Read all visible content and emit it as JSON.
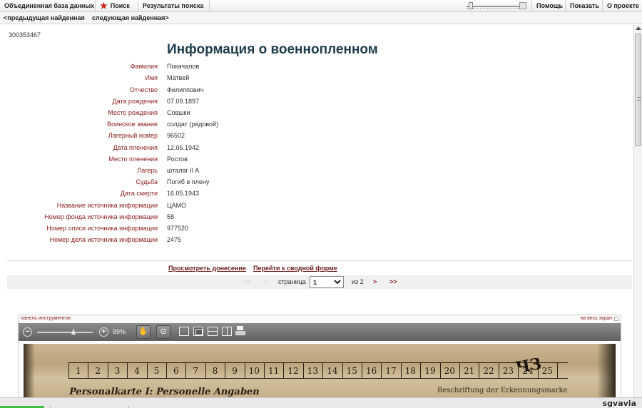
{
  "topbar": {
    "tabs": [
      "Объединенная база данных",
      "Поиск",
      "Результаты поиска"
    ],
    "right_links": [
      "Помощь",
      "Показать",
      "О проекте"
    ],
    "icons": {
      "search": "star-icon",
      "search_color": "#d11f1f"
    }
  },
  "subbar": {
    "prev": "<предыдущая найденная",
    "next": "следующая найденная>"
  },
  "record": {
    "id": "300353467",
    "title": "Информация о военнопленном",
    "fields": [
      {
        "label": "Фамилия",
        "value": "Покачалов"
      },
      {
        "label": "Имя",
        "value": "Матвей"
      },
      {
        "label": "Отчество",
        "value": "Филиппович"
      },
      {
        "label": "Дата рождения",
        "value": "07.09.1897"
      },
      {
        "label": "Место рождения",
        "value": "Совшки"
      },
      {
        "label": "Воинское звание",
        "value": "солдат (рядовой)"
      },
      {
        "label": "Лагерный номер",
        "value": "96502"
      },
      {
        "label": "Дата пленения",
        "value": "12.06.1942"
      },
      {
        "label": "Место пленения",
        "value": "Ростов"
      },
      {
        "label": "Лагерь",
        "value": "шталаг II A"
      },
      {
        "label": "Судьба",
        "value": "Погиб в плену"
      },
      {
        "label": "Дата смерти",
        "value": "16.05.1943"
      },
      {
        "label": "Название источника информации",
        "value": "ЦАМО"
      },
      {
        "label": "Номер фонда источника информации",
        "value": "58"
      },
      {
        "label": "Номер описи источника информации",
        "value": "977520"
      },
      {
        "label": "Номер дела источника информации",
        "value": "2475"
      }
    ],
    "label_color": "#8a1d1d",
    "title_color": "#1f3c4c"
  },
  "actions": {
    "view_report": "Просмотреть донесение",
    "summary_form": "Перейти к сводной форме"
  },
  "pager": {
    "first": "<<",
    "prev": "<",
    "page_label": "страница",
    "page_value": "1",
    "of_label": "из 2",
    "next": ">",
    "last": ">>"
  },
  "viewer": {
    "panel_label": "панель инструментов",
    "fullscreen_label": "на весь экран",
    "zoom_out": "−",
    "zoom_in": "+",
    "zoom_level": "89%",
    "scan_numbers": [
      "1",
      "2",
      "3",
      "4",
      "5",
      "6",
      "7",
      "8",
      "9",
      "10",
      "11",
      "12",
      "13",
      "14",
      "15",
      "16",
      "17",
      "18",
      "19",
      "20",
      "21",
      "22",
      "23",
      "24",
      "25"
    ],
    "scan_text_left": "Personalkarte I: Personelle Angaben",
    "scan_text_right": "Beschriftung der Erkennungsmarke",
    "scan_scribble": "ЧЗ"
  },
  "watermark": "sgvavia"
}
